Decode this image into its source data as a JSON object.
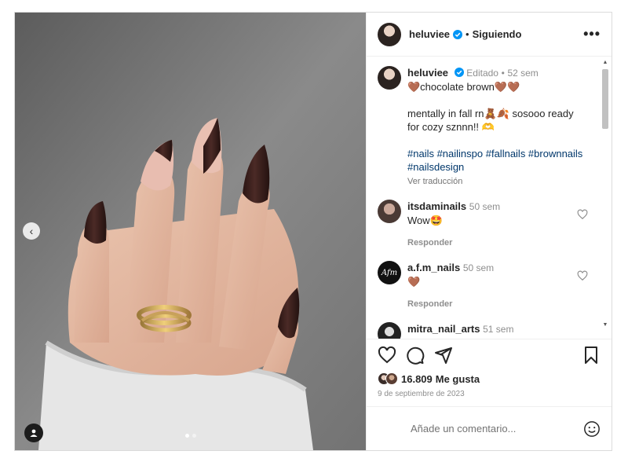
{
  "header": {
    "username": "heluviee",
    "separator": "•",
    "follow_status": "Siguiendo",
    "more_label": "•••"
  },
  "caption": {
    "username": "heluviee",
    "edited": "Editado",
    "separator": "•",
    "time": "52 sem",
    "line1": "🤎chocolate brown🤎🤎",
    "line2": "mentally in fall rn🧸🍂 sosooo ready for cozy sznnn!! 🫶",
    "hashtags": "#nails #nailinspo #fallnails #brownnails #nailsdesign",
    "translate": "Ver traducción"
  },
  "comments": [
    {
      "username": "itsdaminails",
      "time": "50 sem",
      "text": "Wow🤩",
      "reply": "Responder"
    },
    {
      "username": "a.f.m_nails",
      "time": "50 sem",
      "text": "🤎",
      "reply": "Responder",
      "avatar_text": "Afm"
    },
    {
      "username": "mitra_nail_arts",
      "time": "51 sem"
    }
  ],
  "likes": {
    "count": "16.809",
    "label": "Me gusta"
  },
  "date": "9 de septiembre de 2023",
  "add_comment": {
    "placeholder": "Añade un comentario..."
  },
  "nav": {
    "prev": "‹"
  },
  "scroll": {
    "up": "▲",
    "down": "▼"
  },
  "carousel": {
    "current": 1,
    "total": 2
  },
  "colors": {
    "accent": "#0095f6",
    "verified": "#0095f6",
    "hashtag": "#00376b",
    "nail": "#3a1f1c"
  },
  "icons": [
    "verified-icon",
    "more-icon",
    "heart-icon",
    "comment-icon",
    "share-icon",
    "save-icon",
    "emoji-icon",
    "chevron-left-icon",
    "user-tag-icon"
  ]
}
